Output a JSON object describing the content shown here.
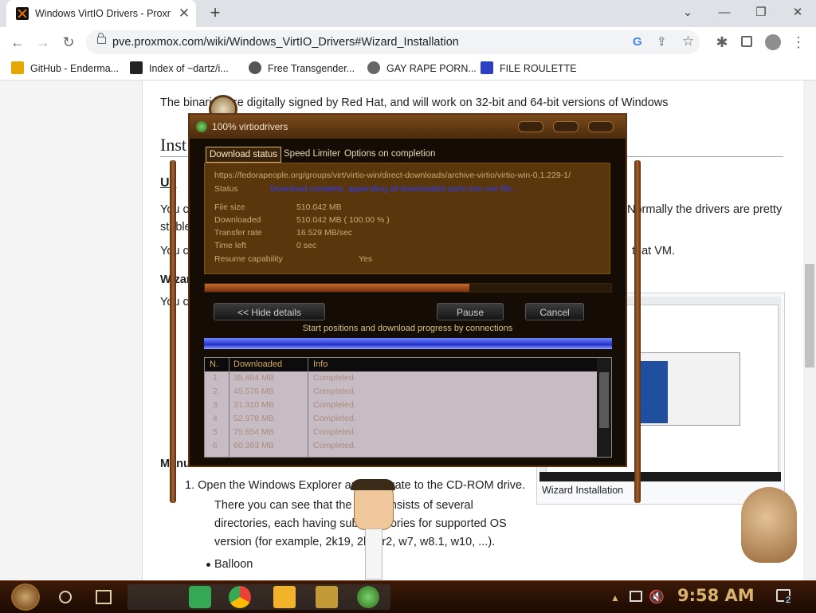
{
  "browser": {
    "tab_title": "Windows VirtIO Drivers - Proxmox",
    "tab_close": "✕",
    "new_tab": "+",
    "url": "pve.proxmox.com/wiki/Windows_VirtIO_Drivers#Wizard_Installation",
    "bookmarks": [
      {
        "label": "GitHub - Enderma...",
        "icon": "ph-icon",
        "color": "#e6a800"
      },
      {
        "label": "Index of ~dartz/i...",
        "icon": "grid-icon",
        "color": "#222222"
      },
      {
        "label": "Free Transgender...",
        "icon": "mask-icon",
        "color": "#555555"
      },
      {
        "label": "GAY RAPE PORN...",
        "icon": "globe-icon",
        "color": "#666666"
      },
      {
        "label": "FILE ROULETTE",
        "icon": "mft-icon",
        "color": "#2b40c4"
      }
    ]
  },
  "article": {
    "intro": "The binaries are digitally signed by Red Hat, and will work on 32-bit and 64-bit versions of Windows",
    "heading_inst": "Inst",
    "heading_us": "Us",
    "line_you_c1": "You c",
    "line_normally": "Normally the drivers are pretty",
    "line_stable": "stable",
    "line_you_c2": "You c",
    "line_that_vm": "that VM.",
    "heading_wizar": "Wizar",
    "line_you_c3": "You c",
    "heading_manu": "Manu",
    "step1": "1. Open the Windows Explorer and navigate to the CD-ROM drive.",
    "para1": "There you can see that the ISO consists of several",
    "para2": "directories, each having sub-directories for supported OS",
    "para3": "version (for example, 2k19, 2k12r2, w7, w8.1, w10, ...).",
    "bullet1": "Balloon",
    "figure_caption": "Wizard Installation"
  },
  "dialog": {
    "title": "100% virtiodrivers",
    "tabs": [
      "Download status",
      "Speed Limiter",
      "Options on completion"
    ],
    "url": "https://fedorapeople.org/groups/virt/virtio-win/direct-downloads/archive-virtio/virtio-win-0.1.229-1/",
    "status_label": "Status",
    "status_value": "Download complete, appending all downloaded parts into one file...",
    "fields": [
      {
        "label": "File size",
        "value": "510.042  MB"
      },
      {
        "label": "Downloaded",
        "value": "510.042  MB  ( 100.00 % )"
      },
      {
        "label": "Transfer rate",
        "value": "16.529  MB/sec"
      },
      {
        "label": "Time left",
        "value": "0 sec"
      }
    ],
    "resume_label": "Resume capability",
    "resume_value": "Yes",
    "progress_fraction": 0.65,
    "hide_details": "<< Hide details",
    "pause": "Pause",
    "cancel": "Cancel",
    "connections_label": "Start positions and download progress by connections",
    "table_headers": [
      "N.",
      "Downloaded",
      "Info"
    ],
    "rows": [
      {
        "n": "1",
        "downloaded": "35.484  MB",
        "info": "Completed."
      },
      {
        "n": "2",
        "downloaded": "45.576  MB",
        "info": "Completed."
      },
      {
        "n": "3",
        "downloaded": "31.310  MB",
        "info": "Completed."
      },
      {
        "n": "4",
        "downloaded": "52.978  MB",
        "info": "Completed."
      },
      {
        "n": "5",
        "downloaded": "75.654  MB",
        "info": "Completed."
      },
      {
        "n": "6",
        "downloaded": "60.393  MB",
        "info": "Completed."
      }
    ]
  },
  "taskbar": {
    "clock": "9:58 AM",
    "notifications": "2"
  }
}
